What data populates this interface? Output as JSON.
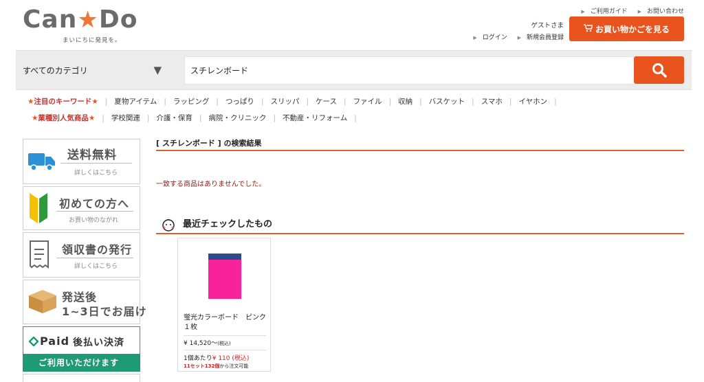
{
  "logo": {
    "text_before": "Can",
    "star": "★",
    "text_after": "Do",
    "tagline": "まいにちに発見を。"
  },
  "header": {
    "top_links": [
      "ご利用ガイド",
      "お問い合わせ"
    ],
    "guest": "ゲストさま",
    "member_links": [
      "ログイン",
      "新規会員登録"
    ],
    "cart_button": "お買い物かごを見る",
    "cart_icon": "cart-icon"
  },
  "search": {
    "category": "すべてのカテゴリ",
    "query": "スチレンボード",
    "button_icon": "search-icon"
  },
  "keywords": {
    "lead": "注目のキーワード",
    "items": [
      "夏物アイテム",
      "ラッピング",
      "つっぱり",
      "スリッパ",
      "ケース",
      "ファイル",
      "収納",
      "バスケット",
      "スマホ",
      "イヤホン"
    ]
  },
  "industry": {
    "lead": "業種別人気商品",
    "items": [
      "学校関連",
      "介護・保育",
      "病院・クリニック",
      "不動産・リフォーム"
    ]
  },
  "sidebar": {
    "shipping": {
      "title": "送料無料",
      "sub": "詳しくはこちら",
      "icon": "truck-icon"
    },
    "beginner": {
      "title": "初めての方へ",
      "sub": "お買い物のながれ",
      "icon": "beginner-mark-icon"
    },
    "receipt": {
      "title": "領収書の発行",
      "sub": "詳しくはこちら",
      "icon": "receipt-icon"
    },
    "delivery": {
      "title": "発送後",
      "title2": "1~3日でお届け",
      "icon": "box-icon"
    },
    "paid": {
      "brand": "Paid",
      "title": "後払い決済",
      "sub": "ご利用いただけます",
      "icon": "paid-logo-icon"
    }
  },
  "main": {
    "result_head": "[ スチレンボード ] の検索結果",
    "no_result": "一致する商品はありませんでした。",
    "recent_title": "最近チェックしたもの",
    "recent_icon": "character-face-icon"
  },
  "product": {
    "name": "蛍光カラーボード　ピンク１枚",
    "price": "¥ 14,520～",
    "price_tax": "(税込)",
    "unit_label": "1個あたり",
    "unit_price": "¥ 110 (税込)",
    "set_note_red": "11セット132個",
    "set_note": "から注文可能"
  },
  "colors": {
    "accent": "#e9531e",
    "divider": "#d9622b",
    "product_pink": "#f8229b"
  }
}
